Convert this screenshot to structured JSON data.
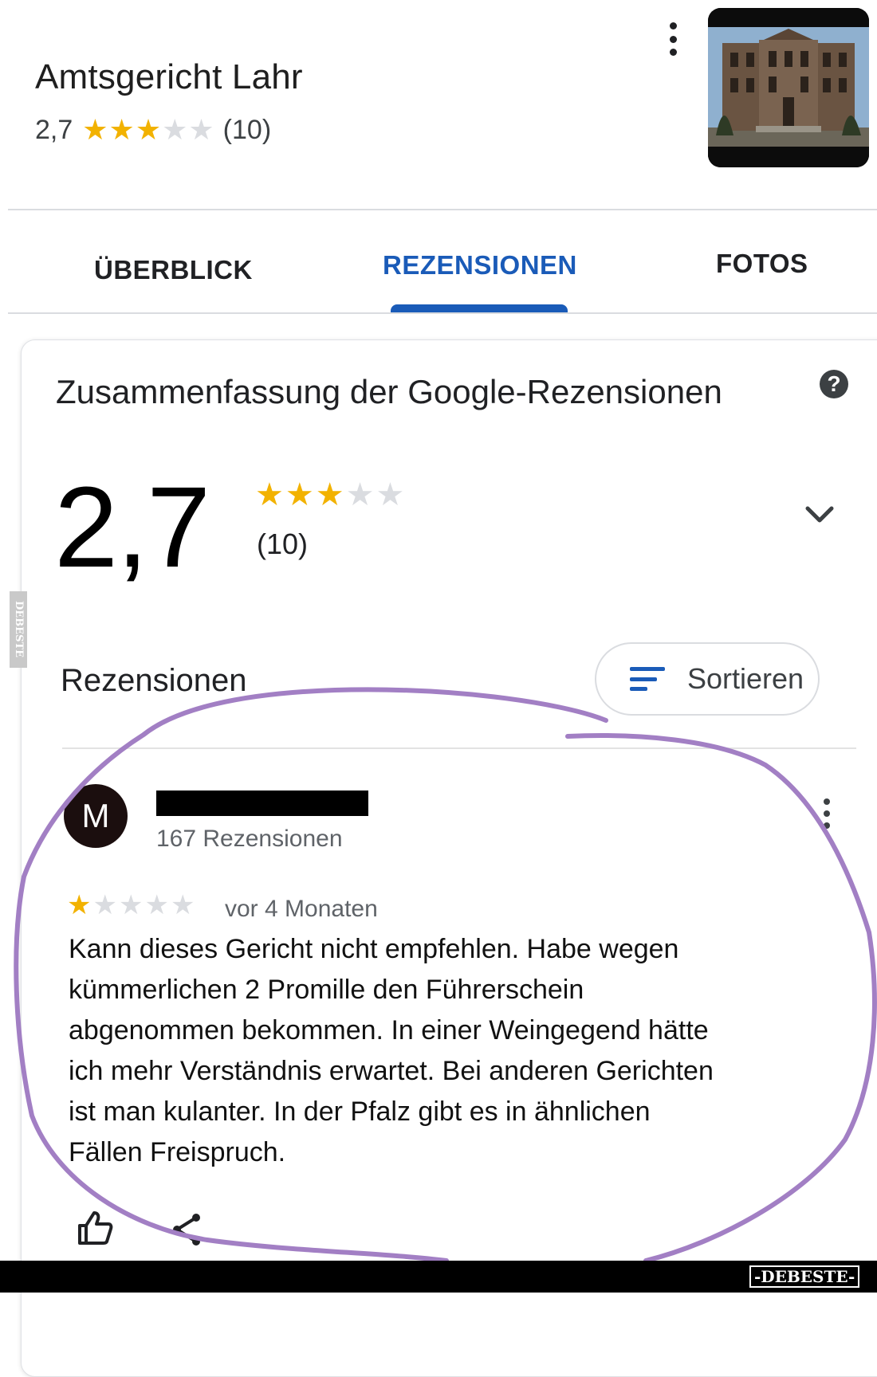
{
  "place": {
    "name": "Amtsgericht Lahr",
    "rating": "2,7",
    "rating_value": 2.7,
    "stars_filled": 3,
    "review_count": "(10)"
  },
  "tabs": [
    {
      "label": "ÜBERBLICK",
      "active": false
    },
    {
      "label": "REZENSIONEN",
      "active": true
    },
    {
      "label": "FOTOS",
      "active": false
    }
  ],
  "summary": {
    "title": "Zusammenfassung der Google-Rezensionen",
    "help_symbol": "?",
    "rating": "2,7",
    "count": "(10)"
  },
  "reviews_section": {
    "heading": "Rezensionen",
    "sort_label": "Sortieren"
  },
  "review": {
    "avatar_initial": "M",
    "reviewer_count": "167 Rezensionen",
    "stars_filled": 1,
    "time": "vor 4 Monaten",
    "lines": [
      "Kann dieses Gericht nicht empfehlen. Habe wegen",
      "kümmerlichen 2 Promille den Führerschein",
      "abgenommen bekommen. In einer Weingegend hätte",
      "ich mehr Verständnis erwartet. Bei anderen Gerichten",
      "ist man kulanter.  In der Pfalz gibt es in ähnlichen",
      "Fällen Freispruch."
    ]
  },
  "watermark": {
    "side": "DEBESTE",
    "footer": "-DEBESTE-"
  },
  "colors": {
    "accent": "#1a5bb8",
    "star_on": "#f2b200",
    "star_off": "#dadce0",
    "annotation": "#a27fc4"
  },
  "icons": [
    "more-vert-icon",
    "help-icon",
    "chevron-down-icon",
    "sort-icon",
    "thumb-up-icon",
    "share-icon"
  ]
}
